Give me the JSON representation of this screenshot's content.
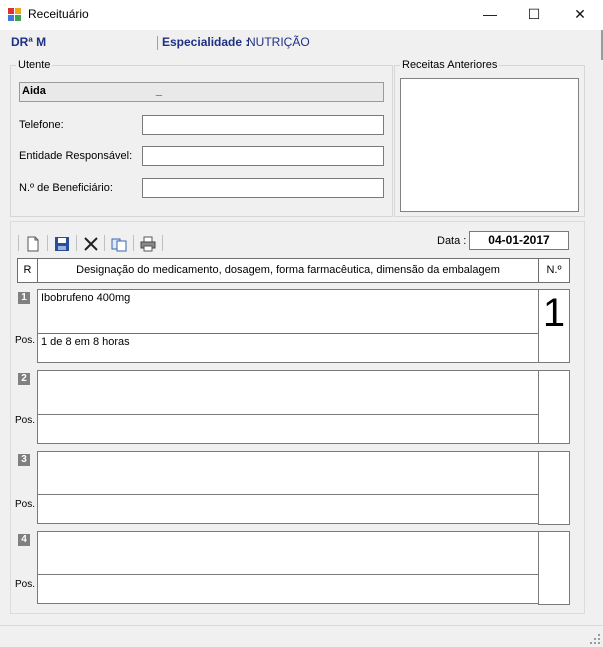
{
  "window": {
    "title": "Receituário",
    "minimize": "—",
    "maximize": "☐",
    "close": "✕"
  },
  "header": {
    "doctor": "DRª M",
    "specialty_label": "Especialidade :",
    "specialty_value": "NUTRIÇÃO"
  },
  "utente": {
    "group_title": "Utente",
    "name": "Aida                                    _",
    "fields": [
      {
        "label": "Telefone:",
        "value": ""
      },
      {
        "label": "Entidade Responsável:",
        "value": ""
      },
      {
        "label": "N.º de Beneficiário:",
        "value": ""
      }
    ]
  },
  "previous": {
    "group_title": "Receitas Anteriores"
  },
  "toolbar": {
    "icons": [
      "new-document-icon",
      "save-icon",
      "delete-icon",
      "copy-icon",
      "print-icon"
    ],
    "date_label": "Data :",
    "date_value": "04-01-2017"
  },
  "table": {
    "headers": {
      "r": "R",
      "designation": "Designação do medicamento, dosagem, forma farmacêutica, dimensão da embalagem",
      "qty": "N.º"
    },
    "pos_label": "Pos.",
    "rows": [
      {
        "num": "1",
        "designation": "Ibobrufeno 400mg",
        "posology": "1 de 8 em 8 horas",
        "qty": "1"
      },
      {
        "num": "2",
        "designation": "",
        "posology": "",
        "qty": ""
      },
      {
        "num": "3",
        "designation": "",
        "posology": "",
        "qty": ""
      },
      {
        "num": "4",
        "designation": "",
        "posology": "",
        "qty": ""
      }
    ]
  },
  "colors": {
    "accent": "#1e2f86",
    "panel": "#f0f0f0",
    "border": "#7a7a7a"
  }
}
